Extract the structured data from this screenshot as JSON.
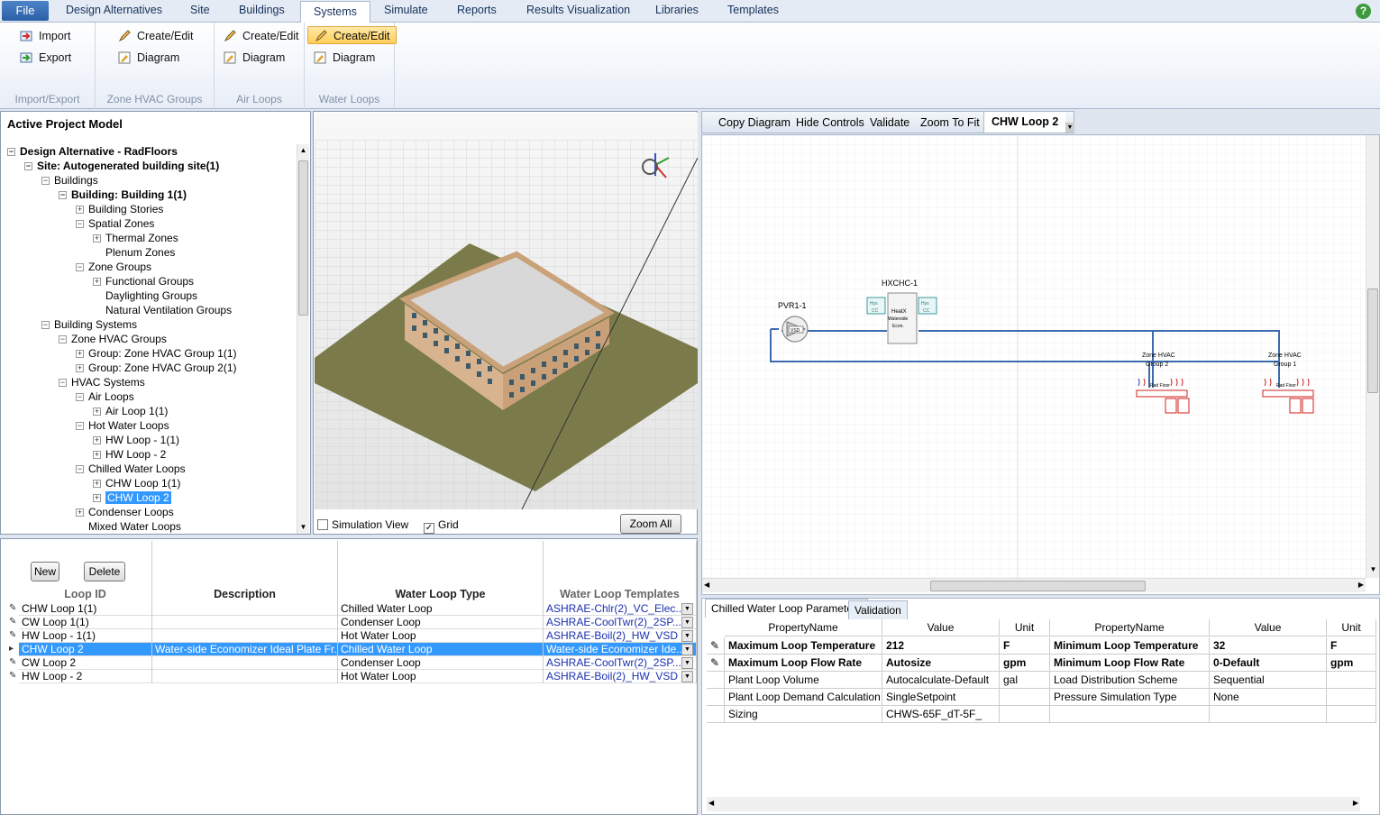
{
  "tabs": {
    "file": "File",
    "items": [
      "Design Alternatives",
      "Site",
      "Buildings",
      "Systems",
      "Simulate",
      "Reports",
      "Results Visualization",
      "Libraries",
      "Templates"
    ],
    "help": "?"
  },
  "ribbon": {
    "import": "Import",
    "export": "Export",
    "group_import_export": "Import/Export",
    "zone_create": "Create/Edit",
    "zone_diagram": "Diagram",
    "group_zone": "Zone HVAC Groups",
    "air_create": "Create/Edit",
    "air_diagram": "Diagram",
    "group_air": "Air Loops",
    "water_create": "Create/Edit",
    "water_diagram": "Diagram",
    "group_water": "Water Loops"
  },
  "tree": {
    "title": "Active Project Model",
    "nodes": [
      {
        "t": "Design Alternative - RadFloors",
        "d": 0,
        "pm": "−",
        "b": true
      },
      {
        "t": "Site: Autogenerated building site(1)",
        "d": 1,
        "pm": "−",
        "b": true
      },
      {
        "t": "Buildings",
        "d": 2,
        "pm": "−"
      },
      {
        "t": "Building: Building  1(1)",
        "d": 3,
        "pm": "−",
        "b": true
      },
      {
        "t": "Building Stories",
        "d": 4,
        "pm": "+"
      },
      {
        "t": "Spatial Zones",
        "d": 4,
        "pm": "−"
      },
      {
        "t": "Thermal Zones",
        "d": 5,
        "pm": "+"
      },
      {
        "t": "Plenum Zones",
        "d": 5,
        "pm": ""
      },
      {
        "t": "Zone Groups",
        "d": 4,
        "pm": "−"
      },
      {
        "t": "Functional Groups",
        "d": 5,
        "pm": "+"
      },
      {
        "t": "Daylighting Groups",
        "d": 5,
        "pm": ""
      },
      {
        "t": "Natural Ventilation Groups",
        "d": 5,
        "pm": ""
      },
      {
        "t": "Building Systems",
        "d": 2,
        "pm": "−"
      },
      {
        "t": "Zone HVAC Groups",
        "d": 3,
        "pm": "−"
      },
      {
        "t": "Group: Zone HVAC Group  1(1)",
        "d": 4,
        "pm": "+"
      },
      {
        "t": "Group: Zone HVAC Group  2(1)",
        "d": 4,
        "pm": "+"
      },
      {
        "t": "HVAC Systems",
        "d": 3,
        "pm": "−"
      },
      {
        "t": "Air Loops",
        "d": 4,
        "pm": "−"
      },
      {
        "t": "Air Loop  1(1)",
        "d": 5,
        "pm": "+"
      },
      {
        "t": "Hot Water Loops",
        "d": 4,
        "pm": "−"
      },
      {
        "t": "HW Loop - 1(1)",
        "d": 5,
        "pm": "+"
      },
      {
        "t": "HW Loop - 2",
        "d": 5,
        "pm": "+"
      },
      {
        "t": "Chilled Water Loops",
        "d": 4,
        "pm": "−"
      },
      {
        "t": "CHW Loop  1(1)",
        "d": 5,
        "pm": "+"
      },
      {
        "t": "CHW Loop  2",
        "d": 5,
        "pm": "+",
        "sel": true
      },
      {
        "t": "Condenser Loops",
        "d": 4,
        "pm": "+"
      },
      {
        "t": "Mixed Water Loops",
        "d": 4,
        "pm": ""
      }
    ]
  },
  "view3d": {
    "simulation_view": "Simulation View",
    "grid": "Grid",
    "zoom_all": "Zoom All",
    "grid_checked": true
  },
  "loopgrid": {
    "new": "New",
    "delete": "Delete",
    "headers": [
      "Loop ID",
      "Description",
      "Water Loop Type",
      "Water Loop Templates"
    ],
    "rows": [
      {
        "id": "CHW Loop  1(1)",
        "desc": "",
        "type": "Chilled Water Loop",
        "tpl": "ASHRAE-Chlr(2)_VC_Elec..."
      },
      {
        "id": "CW Loop  1(1)",
        "desc": "",
        "type": "Condenser Loop",
        "tpl": "ASHRAE-CoolTwr(2)_2SP..."
      },
      {
        "id": "HW Loop - 1(1)",
        "desc": "",
        "type": "Hot Water Loop",
        "tpl": "ASHRAE-Boil(2)_HW_VSD"
      },
      {
        "id": "CHW Loop  2",
        "desc": "Water-side Economizer Ideal Plate Fr...",
        "type": "Chilled Water Loop",
        "tpl": "Water-side Economizer Ide...",
        "sel": true
      },
      {
        "id": "CW Loop  2",
        "desc": "",
        "type": "Condenser Loop",
        "tpl": "ASHRAE-CoolTwr(2)_2SP..."
      },
      {
        "id": "HW Loop - 2",
        "desc": "",
        "type": "Hot Water Loop",
        "tpl": "ASHRAE-Boil(2)_HW_VSD"
      }
    ]
  },
  "diagram_toolbar": {
    "copy": "Copy Diagram",
    "hide": "Hide Controls",
    "validate": "Validate",
    "zoom": "Zoom To Fit",
    "loop": "CHW Loop  2"
  },
  "diagram": {
    "pvr": "PVR1-1",
    "vsd": "VSD",
    "hx": "HXCHC-1",
    "hx_body": "HeatX\nWaterside\nEcon.",
    "hys": "Hys",
    "cc": "CC",
    "zone1": "Zone HVAC\nGroup  2",
    "zone2": "Zone HVAC\nGroup  1",
    "radfloor": "Rad Floor"
  },
  "params": {
    "tab1": "Chilled Water Loop Parameters",
    "tab2": "Validation",
    "headers": [
      "PropertyName",
      "Value",
      "Unit",
      "PropertyName",
      "Value",
      "Unit"
    ],
    "rows": [
      [
        "Maximum Loop Temperature",
        "212",
        "F",
        "Minimum Loop Temperature",
        "32",
        "F"
      ],
      [
        "Maximum Loop Flow Rate",
        "Autosize",
        "gpm",
        "Minimum Loop Flow Rate",
        "0-Default",
        "gpm"
      ],
      [
        "Plant Loop Volume",
        "Autocalculate-Default",
        "gal",
        "Load Distribution Scheme",
        "Sequential",
        ""
      ],
      [
        "Plant Loop Demand Calculation",
        "SingleSetpoint",
        "",
        "Pressure Simulation Type",
        "None",
        ""
      ],
      [
        "Sizing",
        "CHWS-65F_dT-5F_",
        "",
        "",
        "",
        ""
      ]
    ]
  }
}
